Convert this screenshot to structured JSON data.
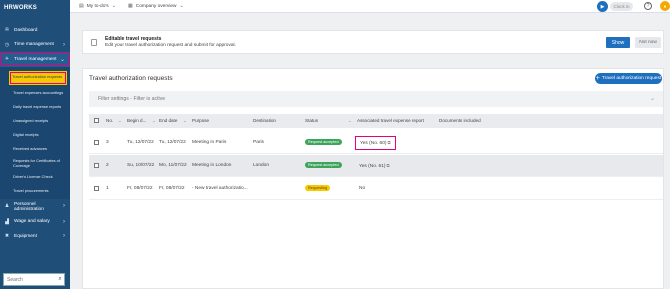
{
  "app": {
    "logo": "HRWORKS"
  },
  "sidebar": {
    "items": [
      {
        "label": "Dashboard",
        "icon": "dashboard-icon",
        "glyph": "✇"
      },
      {
        "label": "Time management",
        "icon": "clock-icon",
        "glyph": "◷"
      },
      {
        "label": "Travel management",
        "icon": "plane-icon",
        "glyph": "✈"
      }
    ],
    "submenu": [
      "Travel authorization requests",
      "Travel expenses accountings",
      "Daily travel expense reports",
      "Unassigned receipts",
      "Digital receipts",
      "Received advances",
      "Requests for Certificates of Coverage",
      "Driver's License Check",
      "Travel procurements"
    ],
    "bottom_items": [
      {
        "label": "Personnel administration",
        "icon": "people-icon",
        "glyph": "♟"
      },
      {
        "label": "Wage and salary",
        "icon": "chart-icon",
        "glyph": "▟"
      },
      {
        "label": "Equipment",
        "icon": "tools-icon",
        "glyph": "✖"
      }
    ],
    "search_placeholder": "Search"
  },
  "topbar": {
    "todos": "My to-do's",
    "company": "Company overview",
    "clock_in": "Clock in",
    "help": "?"
  },
  "banner": {
    "title": "Editable travel requests",
    "text": "Edit your travel authorization request and submit for approval.",
    "show": "Show",
    "not_now": "Not now"
  },
  "main": {
    "title": "Travel authorization requests",
    "add_button": "Travel authorization request",
    "filter": "Filter settings - Filter is active",
    "columns": [
      "No.",
      "Begin d...",
      "End date",
      "Purpose",
      "Destination",
      "Status",
      "Associated travel expense report",
      "Documents included"
    ],
    "rows": [
      {
        "no": "3",
        "begin": "Tu, 12/07/22",
        "end": "Tu, 12/07/22",
        "purpose": "Meeting in Paris",
        "destination": "Paris",
        "status": "Request accepted",
        "report": "Yes (No. 60)"
      },
      {
        "no": "2",
        "begin": "Su, 10/07/22",
        "end": "Mo, 11/07/22",
        "purpose": "Meeting in London",
        "destination": "London",
        "status": "Request accepted",
        "report": "Yes (No. 61)"
      },
      {
        "no": "1",
        "begin": "Fr, 08/07/22",
        "end": "Fr, 08/07/22",
        "purpose": "- New travel authorizatio...",
        "destination": "",
        "status": "Requesting",
        "report": "No"
      }
    ]
  },
  "colors": {
    "sidebar": "#1f4e79",
    "accent": "#1f6fbf",
    "highlight": "#e6007e",
    "selected": "#f6c800",
    "accepted": "#3ca45a"
  }
}
